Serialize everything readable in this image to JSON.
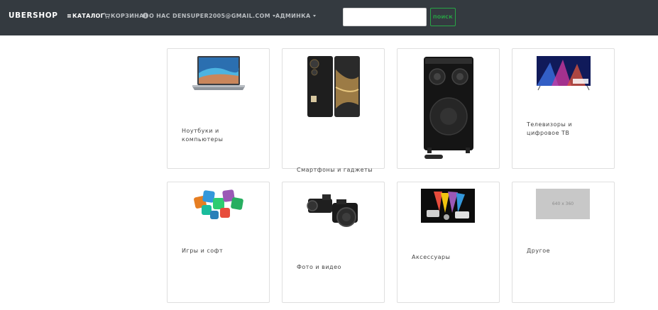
{
  "navbar": {
    "brand": "UBERSHOP",
    "catalog": "КАТАЛОГ",
    "cart": "КОРЗИНА",
    "about": "О НАС",
    "user_email": "DENSUPER2005@GMAIL.COM",
    "admin": "АДМИНКА",
    "search_placeholder": "",
    "search_button": "ПОИСК",
    "accent_color": "#28a745",
    "bg_color": "#343a40"
  },
  "categories": [
    {
      "label": "Ноутбуки и\nкомпьютеры",
      "icon": "laptop-image"
    },
    {
      "label": "Смартфоны и гаджеты",
      "icon": "smartphone-image"
    },
    {
      "label": "",
      "icon": "speaker-image"
    },
    {
      "label": "Телевизоры и\nцифровое ТВ",
      "icon": "tv-image"
    },
    {
      "label": "Игры и софт",
      "icon": "software-icons-image"
    },
    {
      "label": "Фото и видео",
      "icon": "camera-image"
    },
    {
      "label": "Аксессуары",
      "icon": "accessories-image"
    },
    {
      "label": "Другое",
      "icon": "placeholder-image",
      "placeholder_text": "640 x 360"
    }
  ]
}
